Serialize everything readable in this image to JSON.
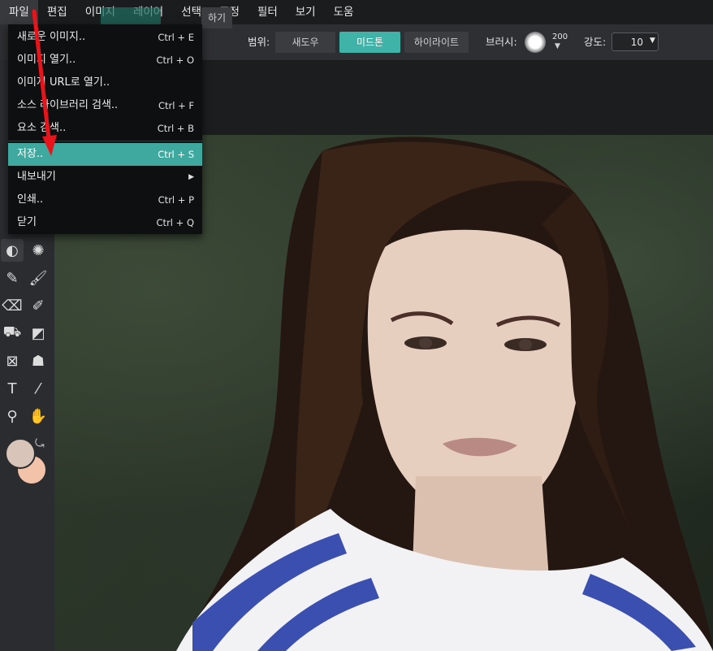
{
  "menubar": {
    "items": [
      {
        "label": "파일"
      },
      {
        "label": "편집"
      },
      {
        "label": "이미지"
      },
      {
        "label": "레이어"
      },
      {
        "label": "선택"
      },
      {
        "label": "조정"
      },
      {
        "label": "필터"
      },
      {
        "label": "보기"
      },
      {
        "label": "도움"
      }
    ]
  },
  "options": {
    "partial_button": "하기",
    "range_label": "범위:",
    "range_options": [
      {
        "label": "새도우",
        "selected": false
      },
      {
        "label": "미드톤",
        "selected": true
      },
      {
        "label": "하이라이트",
        "selected": false
      }
    ],
    "brush_label": "브러시:",
    "brush_size": "200",
    "strength_label": "강도:",
    "strength_value": "10"
  },
  "file_menu": {
    "items": [
      {
        "label": "새로운 이미지..",
        "shortcut": "Ctrl + E"
      },
      {
        "label": "이미지 열기..",
        "shortcut": "Ctrl + O"
      },
      {
        "label": "이미지 URL로 열기..",
        "shortcut": ""
      },
      {
        "label": "소스 라이브러리 검색..",
        "shortcut": "Ctrl + F"
      },
      {
        "label": "요소 검색..",
        "shortcut": "Ctrl + B"
      },
      {
        "label": "저장..",
        "shortcut": "Ctrl + S",
        "highlighted": true
      },
      {
        "label": "내보내기",
        "shortcut": "",
        "submenu": true
      },
      {
        "label": "인쇄..",
        "shortcut": "Ctrl + P"
      },
      {
        "label": "닫기",
        "shortcut": "Ctrl + Q"
      }
    ]
  },
  "colors": {
    "accent": "#3fb3a8",
    "foreground": "#d8c4b8",
    "background": "#f2c3a8",
    "annotation_arrow": "#e8141b"
  },
  "tools": [
    "dodge-burn-icon",
    "sponge-icon",
    "pencil-icon",
    "brush-icon",
    "eraser-icon",
    "clone-stamp-icon",
    "paint-bucket-icon",
    "gradient-icon",
    "shape-icon",
    "smudge-icon",
    "text-icon",
    "color-picker-icon",
    "zoom-icon",
    "hand-icon"
  ]
}
